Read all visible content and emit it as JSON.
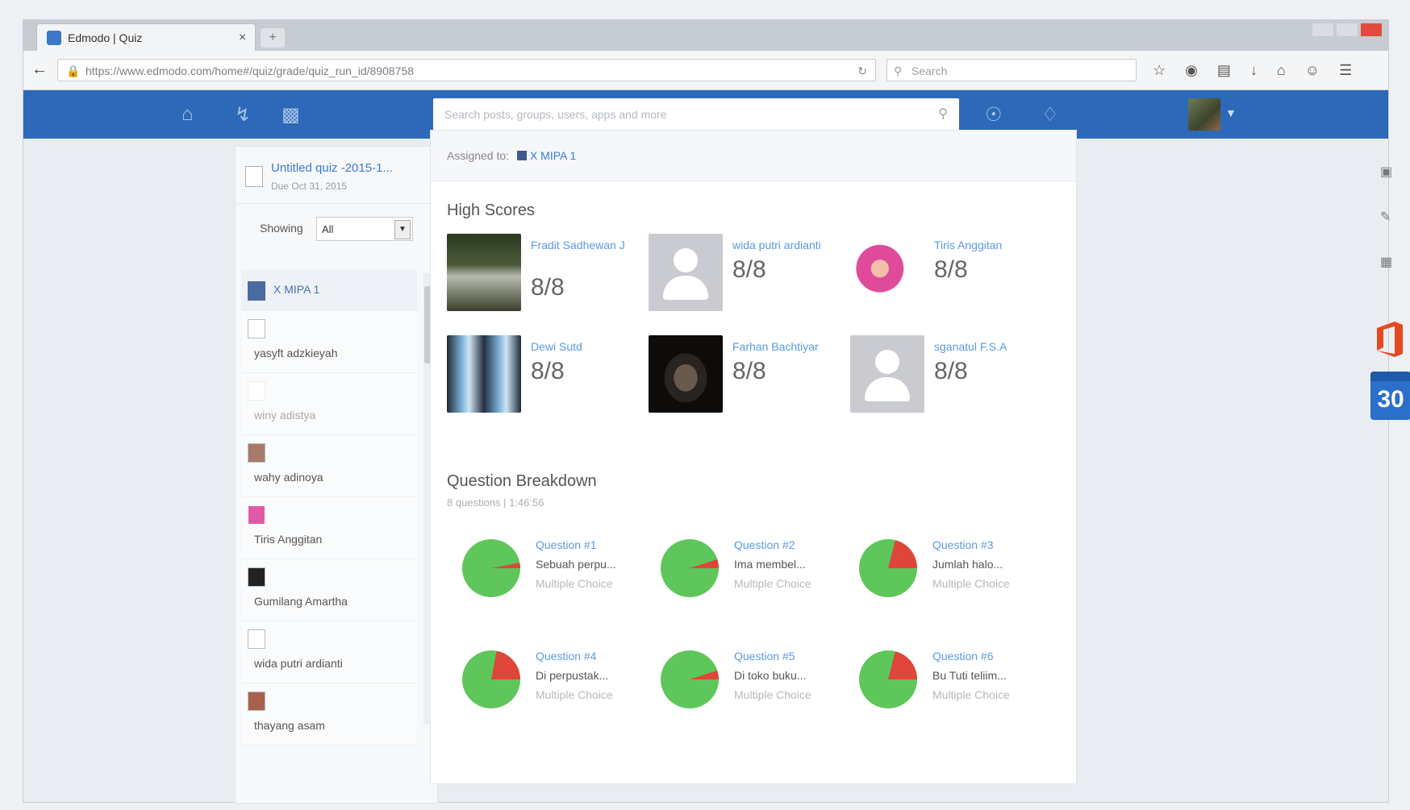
{
  "browser": {
    "tab_title": "Edmodo | Quiz",
    "tab_close": "×",
    "new_tab": "+",
    "url": "https://www.edmodo.com/home#/quiz/grade/quiz_run_id/8908758",
    "search_placeholder": "Search"
  },
  "header": {
    "search_placeholder": "Search posts, groups, users, apps and more"
  },
  "left_panel": {
    "quiz_title": "Untitled quiz -2015-1...",
    "quiz_date": "Due Oct 31, 2015",
    "showing_label": "Showing",
    "showing_value": "All",
    "students": [
      {
        "name": "X MIPA 1"
      },
      {
        "name": "yasyft adzkieyah"
      },
      {
        "name": "winy adistya"
      },
      {
        "name": "wahy adinoya"
      },
      {
        "name": "Tiris Anggitan"
      },
      {
        "name": "Gumilang Amartha"
      },
      {
        "name": "wida putri ardianti"
      },
      {
        "name": "thayang asam"
      }
    ]
  },
  "main": {
    "assigned_label": "Assigned to:",
    "assigned_group": "X MIPA 1",
    "high_scores_title": "High Scores",
    "high_scores": [
      {
        "name": "Fradit Sadhewan J",
        "score": "8/8"
      },
      {
        "name": "wida putri ardianti",
        "score": "8/8"
      },
      {
        "name": "Tiris Anggitan",
        "score": "8/8"
      },
      {
        "name": "Dewi Sutd",
        "score": "8/8"
      },
      {
        "name": "Farhan Bachtiyar",
        "score": "8/8"
      },
      {
        "name": "sganatul F.S.A",
        "score": "8/8"
      }
    ],
    "breakdown_title": "Question Breakdown",
    "breakdown_sub": "8 questions | 1:46:56",
    "questions": [
      {
        "title": "Question #1",
        "preview": "Sebuah perpu...",
        "kind": "Multiple Choice",
        "correct_pct": 97
      },
      {
        "title": "Question #2",
        "preview": "Ima membel...",
        "kind": "Multiple Choice",
        "correct_pct": 95
      },
      {
        "title": "Question #3",
        "preview": "Jumlah halo...",
        "kind": "Multiple Choice",
        "correct_pct": 79
      },
      {
        "title": "Question #4",
        "preview": "Di perpustak...",
        "kind": "Multiple Choice",
        "correct_pct": 78
      },
      {
        "title": "Question #5",
        "preview": "Di toko buku...",
        "kind": "Multiple Choice",
        "correct_pct": 95
      },
      {
        "title": "Question #6",
        "preview": "Bu Tuti teliim...",
        "kind": "Multiple Choice",
        "correct_pct": 79
      }
    ]
  },
  "right_rail": {
    "calendar_day": "30"
  },
  "colors": {
    "brand_blue": "#2d69b8",
    "correct": "#5ec65a",
    "incorrect": "#e0453a"
  }
}
